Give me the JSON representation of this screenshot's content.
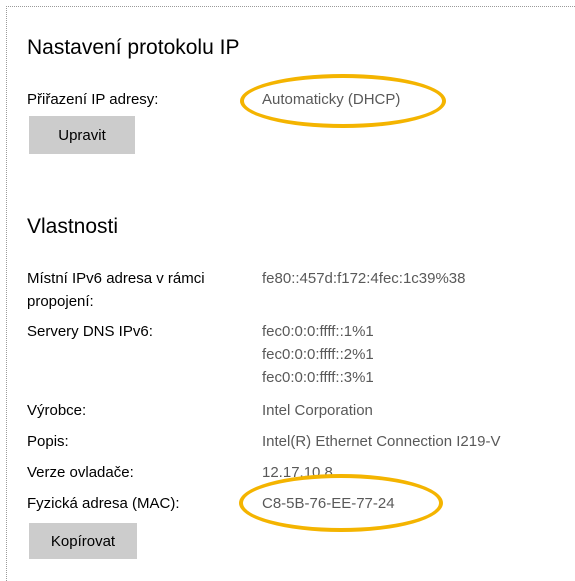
{
  "ip_settings": {
    "title": "Nastavení protokolu IP",
    "assignment_label": "Přiřazení IP adresy:",
    "assignment_value": "Automaticky (DHCP)",
    "edit_button": "Upravit"
  },
  "properties": {
    "title": "Vlastnosti",
    "ipv6_label": "Místní IPv6 adresa v rámci propojení:",
    "ipv6_value": "fe80::457d:f172:4fec:1c39%38",
    "dns_label": "Servery DNS IPv6:",
    "dns_values": [
      "fec0:0:0:ffff::1%1",
      "fec0:0:0:ffff::2%1",
      "fec0:0:0:ffff::3%1"
    ],
    "manufacturer_label": "Výrobce:",
    "manufacturer_value": "Intel Corporation",
    "description_label": "Popis:",
    "description_value": "Intel(R) Ethernet Connection I219-V",
    "driver_label": "Verze ovladače:",
    "driver_value": "12.17.10.8",
    "mac_label": "Fyzická adresa (MAC):",
    "mac_value": "C8-5B-76-EE-77-24",
    "copy_button": "Kopírovat"
  },
  "colors": {
    "highlight": "#f4b400",
    "button_bg": "#cccccc",
    "value_text": "#595959"
  }
}
